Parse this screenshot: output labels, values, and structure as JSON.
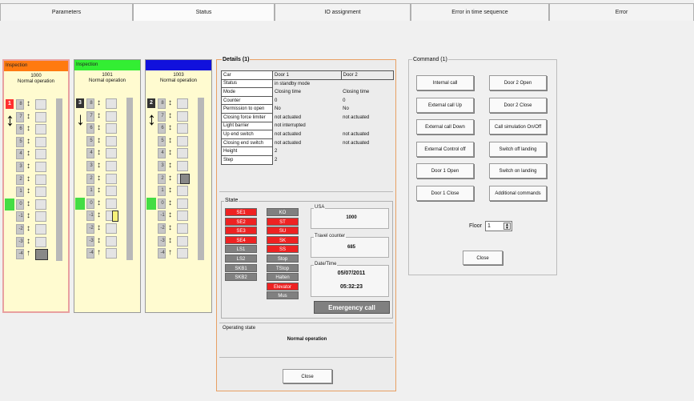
{
  "tabs": [
    {
      "label": "Parameters"
    },
    {
      "label": "Status"
    },
    {
      "label": "IO assignment"
    },
    {
      "label": "Error in time sequence"
    },
    {
      "label": "Error"
    }
  ],
  "elevators": [
    {
      "header": "Inspection",
      "number": "1000",
      "mode": "Normal operation",
      "level_badge": "1",
      "header_color": "#ff7a10"
    },
    {
      "header": "Inspection",
      "number": "1001",
      "mode": "Normal operation",
      "level_badge": "3",
      "header_color": "#33ee33"
    },
    {
      "header": "",
      "number": "1003",
      "mode": "Normal operation",
      "level_badge": "2",
      "header_color": "#1111dd"
    }
  ],
  "floors": [
    "8",
    "7",
    "6",
    "5",
    "4",
    "3",
    "2",
    "1",
    "0",
    "-1",
    "-2",
    "-3",
    "-4"
  ],
  "details": {
    "title": "Details (1)",
    "table": [
      {
        "key": "Car",
        "v1": "Door 1",
        "v2": "Door 2"
      },
      {
        "key": "Status",
        "v1": "in standby mode",
        "v2": ""
      },
      {
        "key": "Mode",
        "v1": "Closing time",
        "v2": "Closing time"
      },
      {
        "key": "Counter",
        "v1": "0",
        "v2": "0"
      },
      {
        "key": "Permission to open",
        "v1": "No",
        "v2": "No"
      },
      {
        "key": "Closing force limiter",
        "v1": "not actuated",
        "v2": "not actuated"
      },
      {
        "key": "Light barrier",
        "v1": "not interrupted",
        "v2": ""
      },
      {
        "key": "Up end switch",
        "v1": "not actuated",
        "v2": "not actuated"
      },
      {
        "key": "Closing end switch",
        "v1": "not actuated",
        "v2": "not actuated"
      },
      {
        "key": "Height",
        "v1": "2",
        "v2": ""
      },
      {
        "key": "Step",
        "v1": "2",
        "v2": ""
      }
    ],
    "state_title": "State",
    "state_left": [
      {
        "label": "SE1",
        "color": "red"
      },
      {
        "label": "SE2",
        "color": "red"
      },
      {
        "label": "SE3",
        "color": "red"
      },
      {
        "label": "SE4",
        "color": "red"
      },
      {
        "label": "LS1",
        "color": "gray"
      },
      {
        "label": "LS2",
        "color": "gray"
      },
      {
        "label": "SKB1",
        "color": "gray"
      },
      {
        "label": "SKB2",
        "color": "gray"
      }
    ],
    "state_right": [
      {
        "label": "KO",
        "color": "gray"
      },
      {
        "label": "ST",
        "color": "red"
      },
      {
        "label": "SU",
        "color": "red"
      },
      {
        "label": "SK",
        "color": "red"
      },
      {
        "label": "SS",
        "color": "red"
      },
      {
        "label": "Stop",
        "color": "gray"
      },
      {
        "label": "TStop",
        "color": "gray"
      },
      {
        "label": "Halten",
        "color": "gray"
      },
      {
        "label": "Elevator",
        "color": "red"
      },
      {
        "label": "Mus",
        "color": "gray"
      }
    ],
    "usa_label": "USA",
    "usa_value": "1000",
    "travel_label": "Travel counter",
    "travel_value": "685",
    "datetime_label": "Date/Time",
    "date_value": "05/07/2011",
    "time_value": "05:32:23",
    "emergency": "Emergency call",
    "op_state_label": "Operating state",
    "op_state_value": "Normal operation",
    "close": "Close"
  },
  "command": {
    "title": "Command (1)",
    "buttons_left": [
      "Internal call",
      "External call Up",
      "External call Down",
      "External Control off",
      "Door 1 Open",
      "Door 1 Close"
    ],
    "buttons_right": [
      "Door 2 Open",
      "Door 2 Close",
      "Call simulation On/Off",
      "Switch off landing",
      "Switch on landing",
      "Additional commands"
    ],
    "floor_label": "Floor",
    "floor_value": "1",
    "close": "Close"
  }
}
